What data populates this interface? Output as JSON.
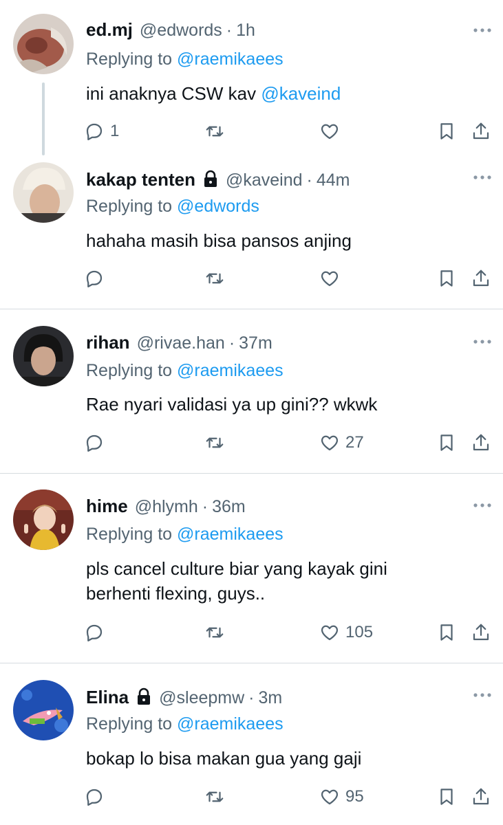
{
  "colors": {
    "link": "#1d9bf0",
    "secondary": "#536471",
    "text": "#0f1419",
    "divider": "#d6dbdf"
  },
  "tweets": [
    {
      "name": "ed.mj",
      "handle": "@edwords",
      "dot": "·",
      "time": "1h",
      "locked": false,
      "reply_prefix": "Replying to",
      "reply_to": "@raemikaees",
      "text_plain": "ini anaknya CSW kav ",
      "text_mention": "@kaveind",
      "reply_count": "1",
      "like_count": "",
      "avatar": "avatar-icon"
    },
    {
      "name": "kakap tenten",
      "handle": "@kaveind",
      "dot": "·",
      "time": "44m",
      "locked": true,
      "reply_prefix": "Replying to",
      "reply_to": "@edwords",
      "text_plain": "hahaha masih bisa pansos anjing",
      "reply_count": "",
      "like_count": "",
      "avatar": "avatar-icon"
    },
    {
      "name": "rihan",
      "handle": "@rivae.han",
      "dot": "·",
      "time": "37m",
      "locked": false,
      "reply_prefix": "Replying to",
      "reply_to": "@raemikaees",
      "text_plain": "Rae nyari validasi ya up gini?? wkwk",
      "reply_count": "",
      "like_count": "27",
      "avatar": "avatar-icon"
    },
    {
      "name": "hime",
      "handle": "@hlymh",
      "dot": "·",
      "time": "36m",
      "locked": false,
      "reply_prefix": "Replying to",
      "reply_to": "@raemikaees",
      "text_line1": "pls cancel culture biar yang kayak gini",
      "text_line2": "berhenti flexing, guys..",
      "reply_count": "",
      "like_count": "105",
      "avatar": "avatar-icon"
    },
    {
      "name": "Elina",
      "handle": "@sleepmw",
      "dot": "·",
      "time": "3m",
      "locked": true,
      "reply_prefix": "Replying to",
      "reply_to": "@raemikaees",
      "text_plain": "bokap lo bisa makan gua yang gaji",
      "reply_count": "",
      "like_count": "95",
      "avatar": "avatar-icon"
    }
  ]
}
